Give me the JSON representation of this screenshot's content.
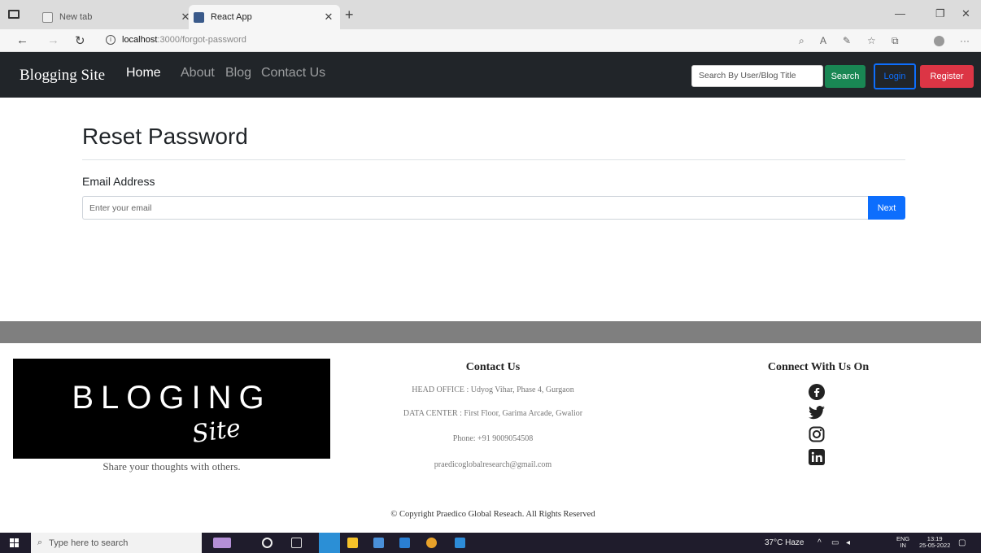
{
  "browser": {
    "tabs": [
      {
        "label": "New tab",
        "active": false
      },
      {
        "label": "React App",
        "active": true
      }
    ],
    "url_host": "localhost",
    "url_path": ":3000/forgot-password"
  },
  "navbar": {
    "brand": "Blogging Site",
    "links": [
      "Home",
      "About",
      "Blog",
      "Contact Us"
    ],
    "active_link": "Home",
    "search_placeholder": "Search By User/Blog Title",
    "search_button": "Search",
    "login_button": "Login",
    "register_button": "Register"
  },
  "main": {
    "title": "Reset Password",
    "email_label": "Email Address",
    "email_placeholder": "Enter your email",
    "email_value": "",
    "next_button": "Next"
  },
  "footer": {
    "logo_main": "BLOGING",
    "logo_script": "Site",
    "tagline": "Share your thoughts with others.",
    "contact_title": "Contact Us",
    "contact_lines": [
      "HEAD OFFICE : Udyog Vihar, Phase 4, Gurgaon",
      "DATA CENTER : First Floor, Garima Arcade, Gwalior",
      "Phone: +91 9009054508",
      "praedicoglobalresearch@gmail.com"
    ],
    "connect_title": "Connect With Us On",
    "social_icons": [
      "facebook-icon",
      "twitter-icon",
      "instagram-icon",
      "linkedin-icon"
    ],
    "copyright": "© Copyright Praedico Global Reseach. All Rights Reserved"
  },
  "taskbar": {
    "search_placeholder": "Type here to search",
    "weather": "37°C Haze",
    "language": "ENG",
    "region": "IN",
    "time": "13:19",
    "date": "25-05-2022"
  },
  "colors": {
    "navbar_bg": "#212529",
    "search_green": "#198754",
    "login_blue": "#0d6efd",
    "register_red": "#dc3545",
    "next_blue": "#0d6efd",
    "footer_band": "#7f7f7f"
  }
}
